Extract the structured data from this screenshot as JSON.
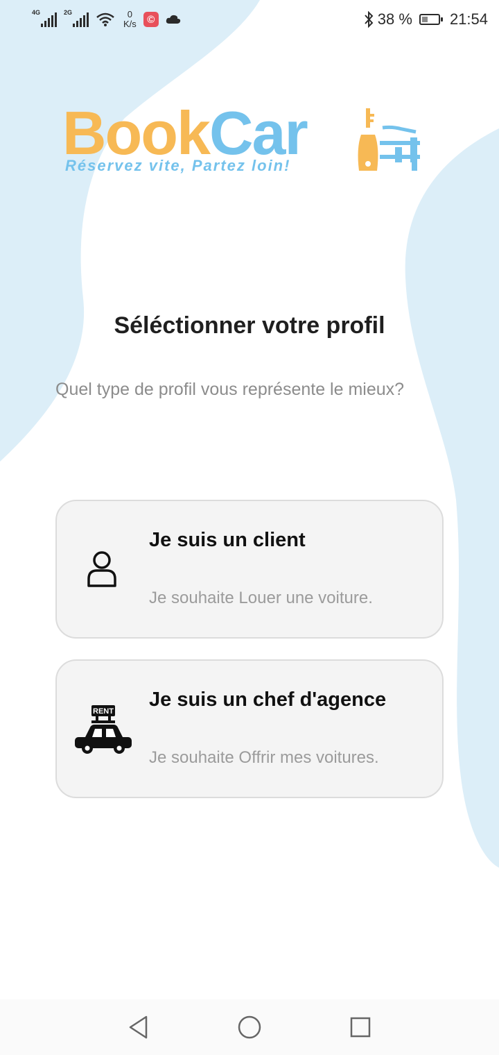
{
  "status_bar": {
    "network_1": "4G",
    "network_2": "2G",
    "speed_value": "0",
    "speed_unit": "K/s",
    "battery_percent": "38 %",
    "battery_level": 0.38,
    "time": "21:54",
    "icons": [
      "signal-icon",
      "signal-icon",
      "wifi-icon",
      "app-notification-icon",
      "cloud-icon",
      "bluetooth-icon",
      "battery-icon"
    ]
  },
  "logo": {
    "brand_part1": "Book",
    "brand_part2": "Car",
    "tagline": "Réservez vite, Partez loin!",
    "colors": {
      "book": "#f7b955",
      "car": "#74c2ec"
    }
  },
  "page": {
    "title": "Séléctionner votre profil",
    "subtitle": "Quel type de profil vous représente le mieux?"
  },
  "profiles": [
    {
      "title": "Je suis un client",
      "description": "Je souhaite Louer une voiture.",
      "icon": "user-icon"
    },
    {
      "title": "Je suis un chef d'agence",
      "description": "Je souhaite Offrir mes voitures.",
      "icon": "rent-car-icon",
      "badge": "RENT"
    }
  ],
  "nav_bar": {
    "icons": [
      "back-icon",
      "home-icon",
      "recents-icon"
    ]
  },
  "colors": {
    "background_blob": "#dceef8",
    "card_bg": "#f4f4f4",
    "card_border": "#dcdcdc"
  }
}
